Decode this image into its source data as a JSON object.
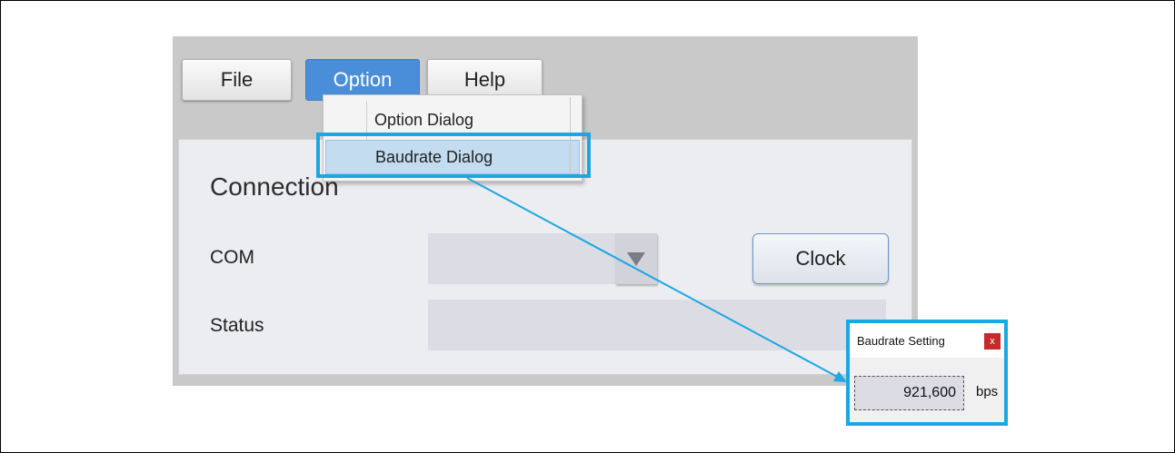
{
  "menubar": {
    "items": [
      {
        "label": "File"
      },
      {
        "label": "Option"
      },
      {
        "label": "Help"
      }
    ]
  },
  "dropdown": {
    "items": [
      {
        "label": "Option Dialog"
      },
      {
        "label": "Baudrate Dialog"
      }
    ]
  },
  "panel": {
    "title": "Connection",
    "com_label": "COM",
    "status_label": "Status",
    "clock_label": "Clock"
  },
  "dialog": {
    "title": "Baudrate Setting",
    "close_glyph": "x",
    "value": "921,600",
    "unit": "bps"
  },
  "colors": {
    "highlight": "#1ba7e6",
    "active_menu": "#4a8ed9",
    "close_button": "#c62b2b"
  }
}
